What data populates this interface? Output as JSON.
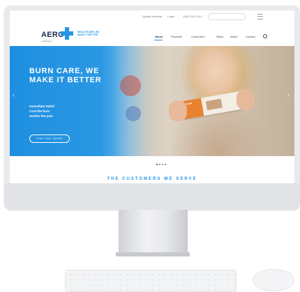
{
  "topbar": {
    "links": [
      "Quality Website",
      "Login",
      "1300 XXX XXX"
    ],
    "search_placeholder": ""
  },
  "header": {
    "logo_text": "AERO",
    "logo_subtext": "healthcare",
    "tagline": "HEALTHCARE, WE MAKE IT BETTER"
  },
  "nav": {
    "items": [
      "Home",
      "Products",
      "Customers",
      "News",
      "About",
      "Contact"
    ],
    "active_index": 0
  },
  "hero": {
    "title": "BURN CARE, WE MAKE IT BETTER",
    "list": [
      "Immediate Relief",
      "Cool the burn",
      "Soothe the pain"
    ],
    "button_label": "FIND OUT MORE",
    "product_label": "burnaid",
    "prev_arrow": "‹",
    "next_arrow": "›",
    "slide_count": 4,
    "active_slide": 0
  },
  "section": {
    "title": "THE CUSTOMERS WE SERVE"
  },
  "colors": {
    "accent": "#2596e6",
    "navy": "#1b2d4d",
    "hero_blue": "#1e8fe0",
    "product_orange": "#e8822e"
  },
  "icons": {
    "search": "search-icon",
    "menu": "hamburger-menu-icon",
    "logo_cross": "plus-cross-icon"
  }
}
